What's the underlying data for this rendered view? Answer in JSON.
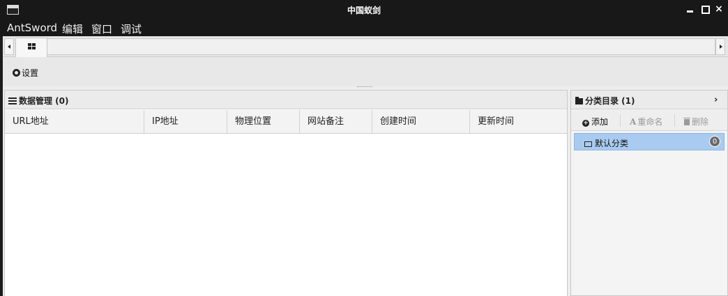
{
  "window": {
    "title": "中国蚁剑",
    "close_glyph": "×"
  },
  "menu": {
    "items": [
      "AntSword",
      "编辑",
      "窗口",
      "调试"
    ]
  },
  "toolbar": {
    "settings_label": "设置"
  },
  "data_panel": {
    "title": "数据管理 (0)",
    "columns": [
      "URL地址",
      "IP地址",
      "物理位置",
      "网站备注",
      "创建时间",
      "更新时间"
    ]
  },
  "category_panel": {
    "title": "分类目录 (1)",
    "collapse_glyph": "›",
    "add_label": "添加",
    "rename_label": "重命名",
    "delete_label": "删除",
    "rename_glyph": "A",
    "add_glyph": "+",
    "items": [
      {
        "label": "默认分类",
        "count": "0"
      }
    ]
  },
  "colors": {
    "titlebar_bg": "#181818",
    "selection_bg": "#a9cbef",
    "panel_bg": "#ededed"
  }
}
